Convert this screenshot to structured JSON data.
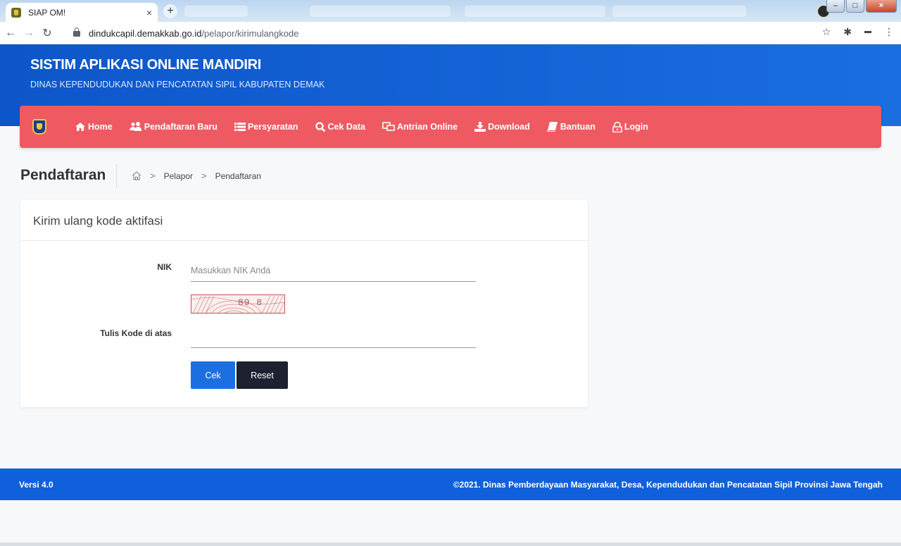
{
  "browser": {
    "tab_title": "SIAP OM!",
    "tab_close": "×",
    "new_tab": "+",
    "url_domain": "dindukcapil.demakkab.go.id",
    "url_path": "/pelapor/kirimulangkode"
  },
  "header": {
    "title": "SISTIM APLIKASI ONLINE MANDIRI",
    "subtitle": "DINAS KEPENDUDUKAN DAN PENCATATAN SIPIL KABUPATEN DEMAK"
  },
  "nav": {
    "items": [
      {
        "label": "Home",
        "icon": "home-icon"
      },
      {
        "label": "Pendaftaran Baru",
        "icon": "users-icon"
      },
      {
        "label": "Persyaratan",
        "icon": "list-icon"
      },
      {
        "label": "Cek Data",
        "icon": "search-icon"
      },
      {
        "label": "Antrian Online",
        "icon": "monitor-icon"
      },
      {
        "label": "Download",
        "icon": "download-icon"
      },
      {
        "label": "Bantuan",
        "icon": "book-icon"
      },
      {
        "label": "Login",
        "icon": "lock-icon"
      }
    ]
  },
  "page": {
    "title": "Pendaftaran",
    "breadcrumb": [
      "Pelapor",
      "Pendaftaran"
    ]
  },
  "form": {
    "card_title": "Kirim ulang kode aktifasi",
    "nik_label": "NIK",
    "nik_placeholder": "Masukkan NIK Anda",
    "captcha_text": "89 8",
    "code_label": "Tulis Kode di atas",
    "submit_label": "Cek",
    "reset_label": "Reset"
  },
  "footer": {
    "version": "Versi 4.0",
    "copyright": "©2021. Dinas Pemberdayaan Masyarakat, Desa, Kependudukan dan Pencatatan Sipil Provinsi Jawa Tengah"
  },
  "colors": {
    "header_blue": "#0d56c9",
    "nav_red": "#ef5a62",
    "button_blue": "#1c6fe0",
    "button_dark": "#1d2132",
    "footer_blue": "#1160db"
  }
}
